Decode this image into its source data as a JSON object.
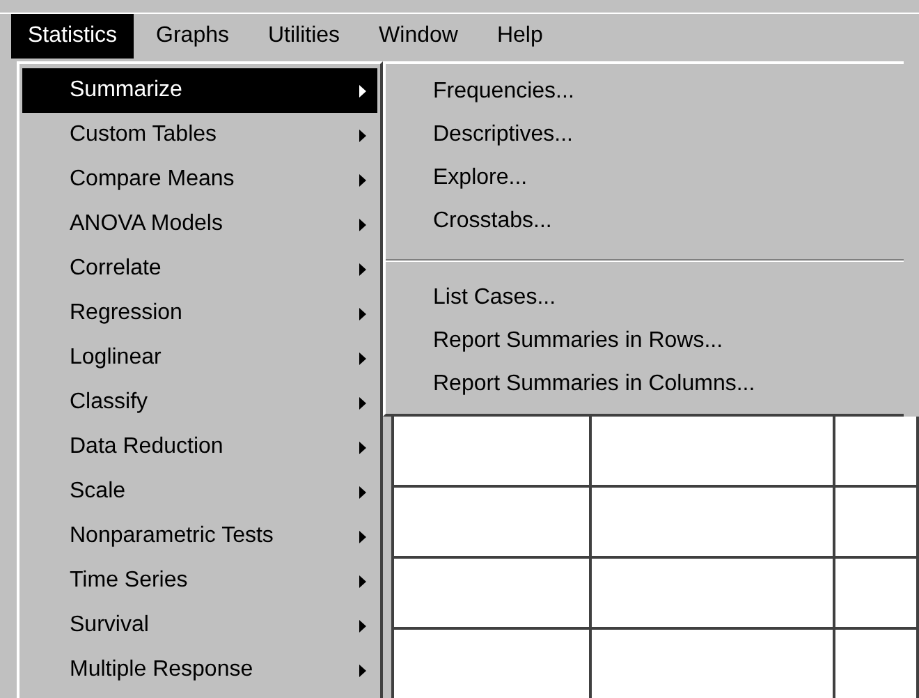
{
  "menu_bar": [
    {
      "label": "Statistics",
      "selected": true
    },
    {
      "label": "Graphs",
      "selected": false
    },
    {
      "label": "Utilities",
      "selected": false
    },
    {
      "label": "Window",
      "selected": false
    },
    {
      "label": "Help",
      "selected": false
    }
  ],
  "menu": {
    "items": [
      {
        "label": "Summarize",
        "selected": true
      },
      {
        "label": "Custom Tables",
        "selected": false
      },
      {
        "label": "Compare Means",
        "selected": false
      },
      {
        "label": "ANOVA Models",
        "selected": false
      },
      {
        "label": "Correlate",
        "selected": false
      },
      {
        "label": "Regression",
        "selected": false
      },
      {
        "label": "Loglinear",
        "selected": false
      },
      {
        "label": "Classify",
        "selected": false
      },
      {
        "label": "Data Reduction",
        "selected": false
      },
      {
        "label": "Scale",
        "selected": false
      },
      {
        "label": "Nonparametric Tests",
        "selected": false
      },
      {
        "label": "Time Series",
        "selected": false
      },
      {
        "label": "Survival",
        "selected": false
      },
      {
        "label": "Multiple Response",
        "selected": false
      }
    ]
  },
  "submenu": {
    "groups": [
      [
        {
          "label": "Frequencies..."
        },
        {
          "label": "Descriptives..."
        },
        {
          "label": "Explore..."
        },
        {
          "label": "Crosstabs..."
        }
      ],
      [
        {
          "label": "List Cases..."
        },
        {
          "label": "Report Summaries in Rows..."
        },
        {
          "label": "Report Summaries in Columns..."
        }
      ]
    ]
  }
}
